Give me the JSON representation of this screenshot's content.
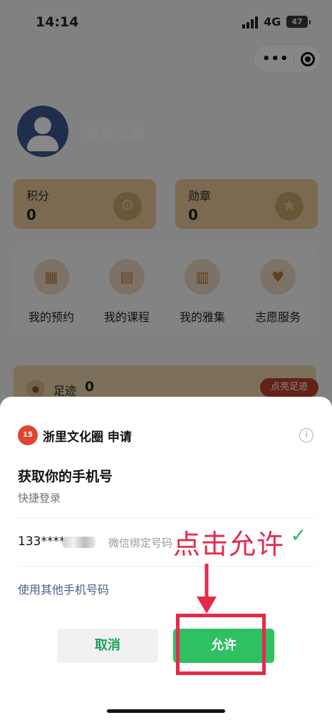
{
  "status_bar": {
    "time": "14:14",
    "network": "4G",
    "battery": "47"
  },
  "capsule": {
    "more_icon": "more-dots-icon",
    "close_icon": "close-target-icon"
  },
  "profile": {
    "login_label": "登录/注册",
    "avatar_icon": "user-avatar-icon"
  },
  "stats": [
    {
      "label": "积分",
      "value": "0",
      "icon": "money-bag-icon"
    },
    {
      "label": "勋章",
      "value": "0",
      "icon": "medal-icon"
    }
  ],
  "grid": [
    {
      "label": "我的预约",
      "icon": "calendar-icon"
    },
    {
      "label": "我的课程",
      "icon": "course-book-icon"
    },
    {
      "label": "我的雅集",
      "icon": "collection-icon"
    },
    {
      "label": "志愿服务",
      "icon": "heart-handshake-icon"
    }
  ],
  "footprint": {
    "label": "足迹",
    "value": "0",
    "button": "点亮足迹"
  },
  "sheet": {
    "app_name": "浙里文化圈 申请",
    "title": "获取你的手机号",
    "subtitle": "快捷登录",
    "phone": "133****",
    "bind_label": "微信绑定号码",
    "other_phone": "使用其他手机号码",
    "cancel": "取消",
    "allow": "允许"
  },
  "annotation": {
    "text": "点击允许",
    "color": "#e6294b"
  },
  "colors": {
    "accent_green": "#2ec061",
    "brand_red": "#e0452f",
    "card_gold": "#e9c998"
  }
}
